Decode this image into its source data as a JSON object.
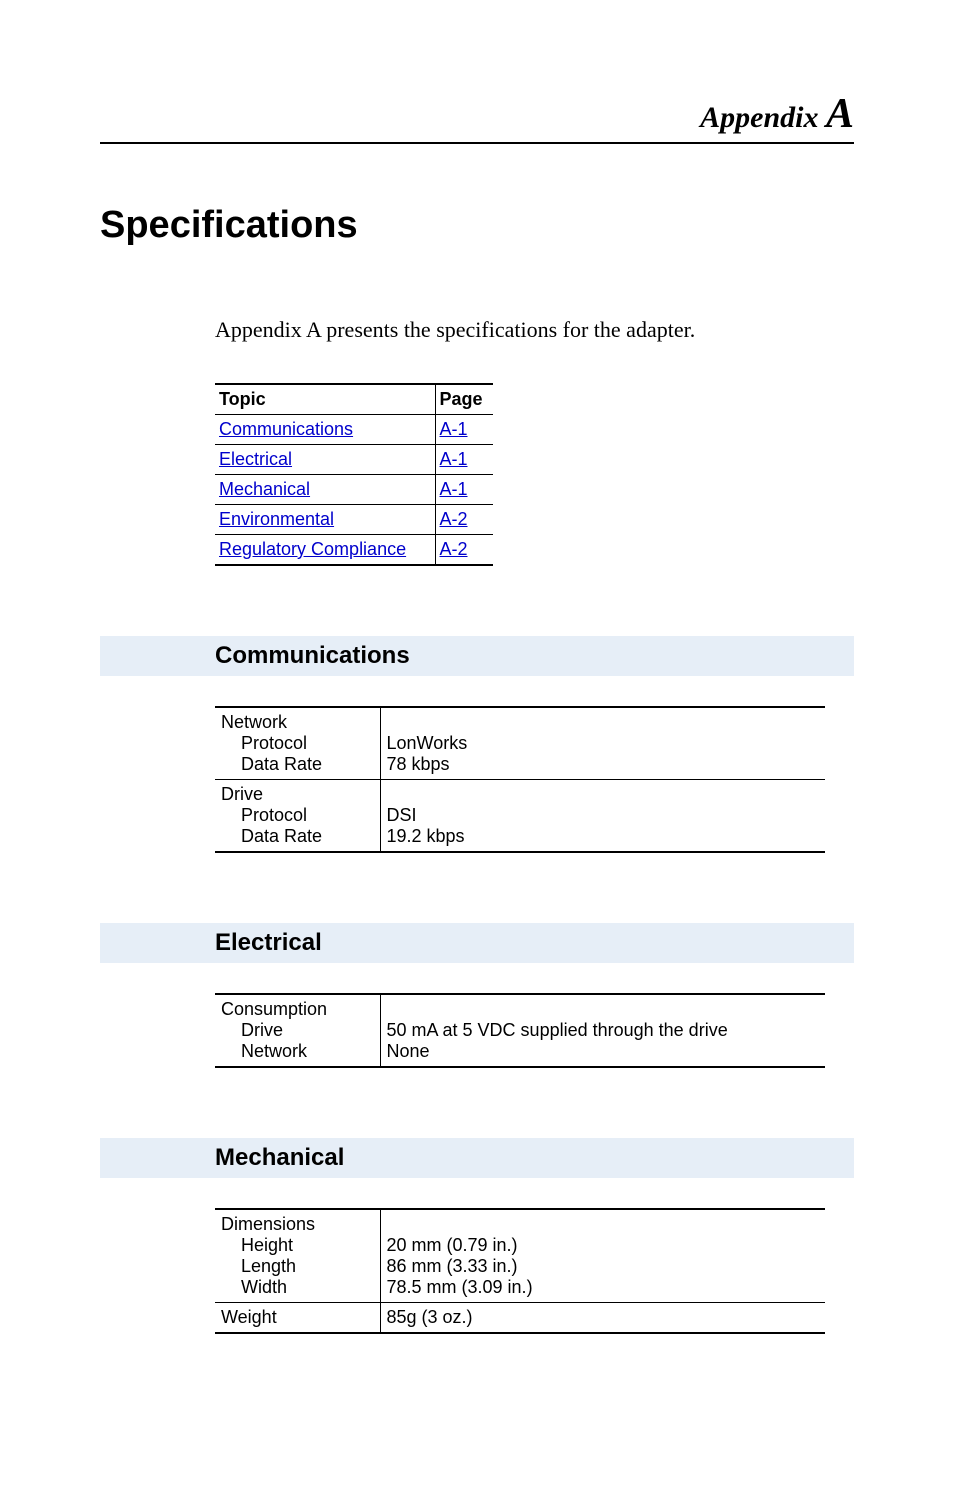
{
  "appendix": {
    "label": "Appendix ",
    "letter": "A"
  },
  "title": "Specifications",
  "intro": "Appendix A presents the specifications for the adapter.",
  "topic_table": {
    "headers": [
      "Topic",
      "Page"
    ],
    "rows": [
      {
        "label": "Communications",
        "page": "A-1"
      },
      {
        "label": "Electrical",
        "page": "A-1"
      },
      {
        "label": "Mechanical",
        "page": "A-1"
      },
      {
        "label": "Environmental",
        "page": "A-2"
      },
      {
        "label": "Regulatory Compliance",
        "page": "A-2"
      }
    ]
  },
  "sections": {
    "communications": {
      "heading": "Communications",
      "rows": [
        {
          "label": "Network",
          "sub": [
            "Protocol",
            "Data Rate"
          ],
          "vals": [
            "LonWorks",
            "78 kbps"
          ]
        },
        {
          "label": "Drive",
          "sub": [
            "Protocol",
            "Data Rate"
          ],
          "vals": [
            "DSI",
            "19.2 kbps"
          ]
        }
      ]
    },
    "electrical": {
      "heading": "Electrical",
      "rows": [
        {
          "label": "Consumption",
          "sub": [
            "Drive",
            "Network"
          ],
          "vals": [
            "50 mA at 5 VDC supplied through the drive",
            "None"
          ]
        }
      ]
    },
    "mechanical": {
      "heading": "Mechanical",
      "rows": [
        {
          "label": "Dimensions",
          "sub": [
            "Height",
            "Length",
            "Width"
          ],
          "vals": [
            "20 mm (0.79 in.)",
            "86 mm (3.33 in.)",
            "78.5 mm (3.09 in.)"
          ]
        },
        {
          "label": "Weight",
          "sub": [],
          "vals": [
            "85g (3 oz.)"
          ]
        }
      ]
    }
  }
}
